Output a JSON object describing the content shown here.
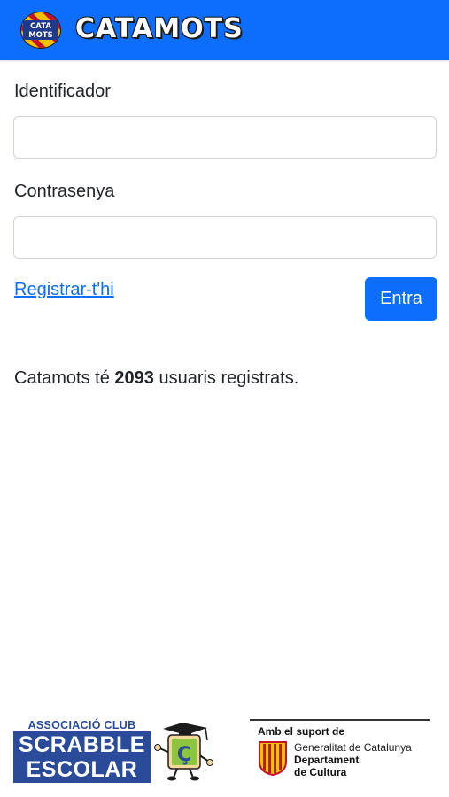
{
  "header": {
    "logo_text_line1": "CATA",
    "logo_text_line2": "MOTS",
    "title": "CATAMOTS",
    "background_color": "#0d6efd"
  },
  "login_form": {
    "identifier_label": "Identificador",
    "identifier_value": "",
    "password_label": "Contrasenya",
    "password_value": "",
    "register_link": "Registrar-t'hi",
    "submit_label": "Entra"
  },
  "stats": {
    "prefix": "Catamots té",
    "user_count": "2093",
    "suffix": "usuaris registrats."
  },
  "footer": {
    "scrabble": {
      "line1": "ASSOCIACIÓ CLUB",
      "line2": "SCRABBLE",
      "line3": "ESCOLAR",
      "mascot_letter": "Ç",
      "color": "#2a4a9a"
    },
    "support": {
      "title": "Amb el suport de",
      "line1": "Generalitat de Catalunya",
      "line2": "Departament",
      "line3": "de Cultura"
    }
  }
}
